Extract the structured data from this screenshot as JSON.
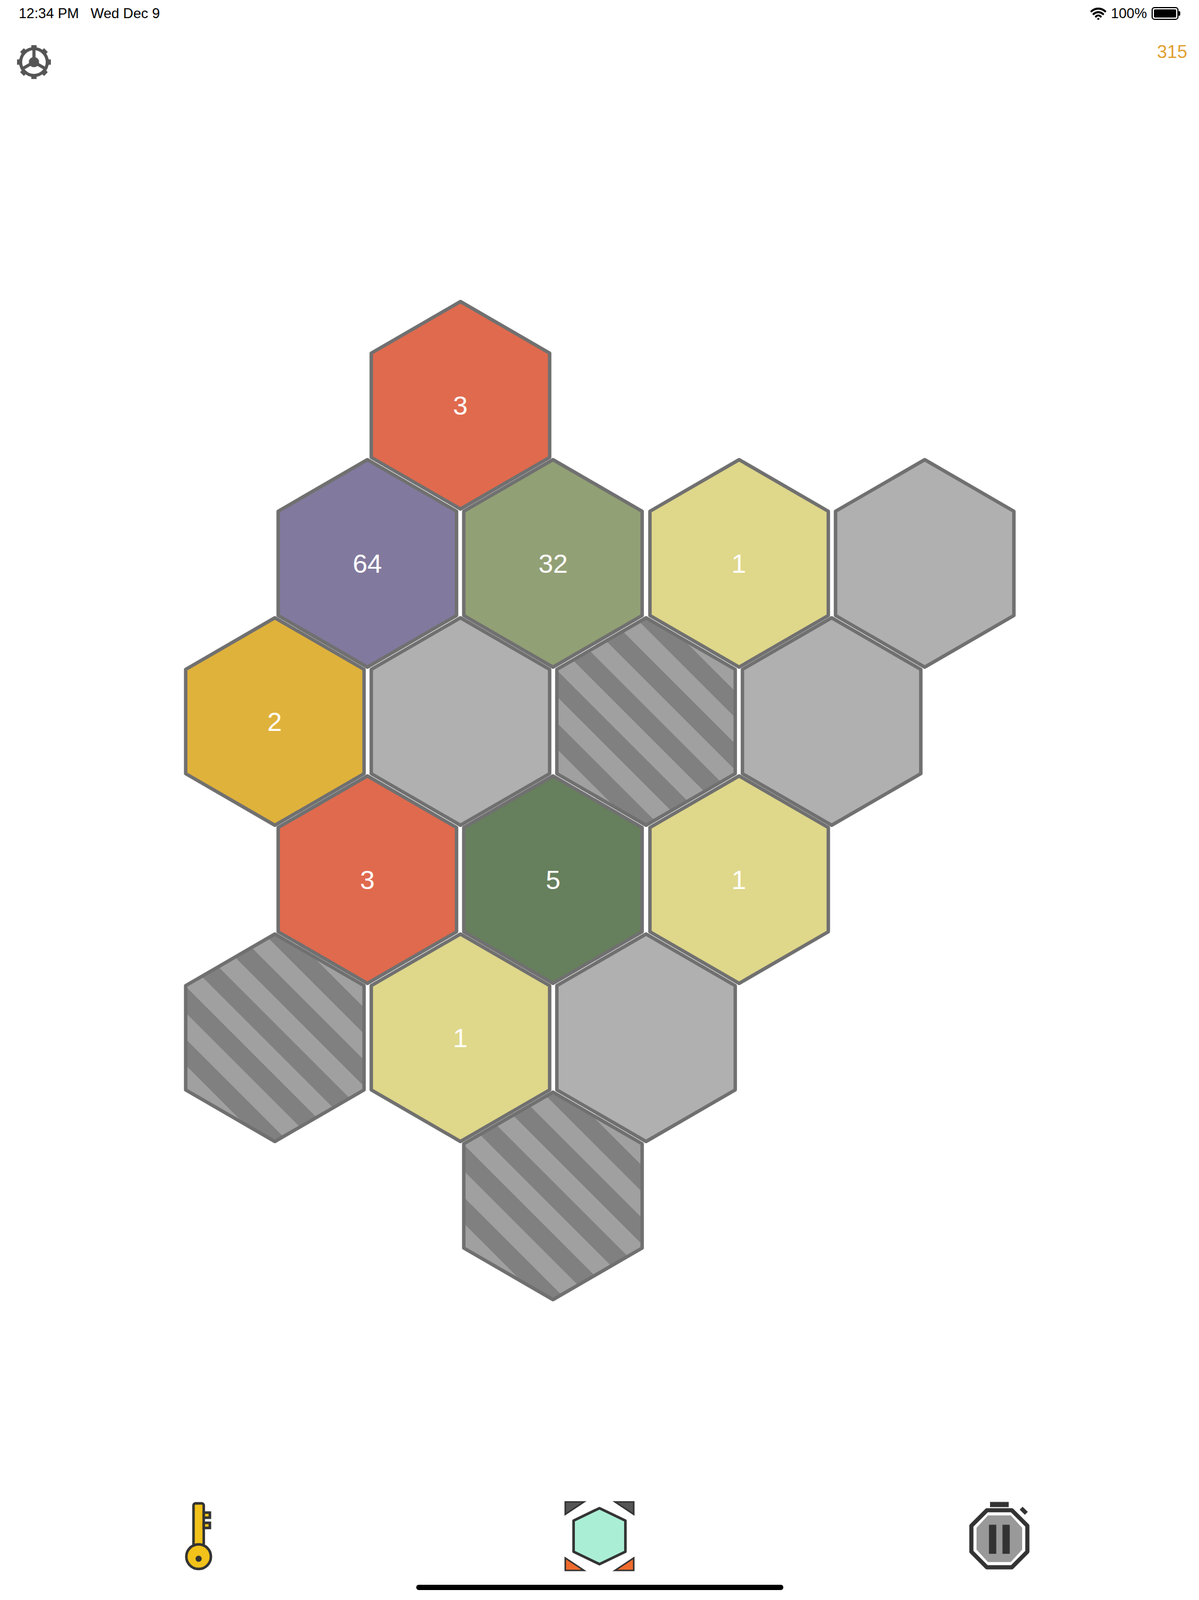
{
  "status_bar": {
    "time": "12:34 PM",
    "date": "Wed Dec 9",
    "battery": "100%",
    "battery_level": 1.0
  },
  "score": "315",
  "board": {
    "cells": [
      {
        "row": 0,
        "col": 2,
        "kind": "number",
        "value": "3",
        "color": "#e06a4e"
      },
      {
        "row": 1,
        "col": 1,
        "kind": "number",
        "value": "64",
        "color": "#82799e"
      },
      {
        "row": 1,
        "col": 3,
        "kind": "number",
        "value": "32",
        "color": "#92a075"
      },
      {
        "row": 1,
        "col": 5,
        "kind": "number",
        "value": "1",
        "color": "#dfd78a"
      },
      {
        "row": 1,
        "col": 7,
        "kind": "empty",
        "color": "#b0b0b0"
      },
      {
        "row": 2,
        "col": 0,
        "kind": "number",
        "value": "2",
        "color": "#dfb23b"
      },
      {
        "row": 2,
        "col": 2,
        "kind": "empty",
        "color": "#b0b0b0"
      },
      {
        "row": 2,
        "col": 4,
        "kind": "blocked",
        "color": "#808080"
      },
      {
        "row": 2,
        "col": 6,
        "kind": "empty",
        "color": "#b0b0b0"
      },
      {
        "row": 3,
        "col": 1,
        "kind": "number",
        "value": "3",
        "color": "#e06a4e"
      },
      {
        "row": 3,
        "col": 3,
        "kind": "number",
        "value": "5",
        "color": "#667f5c"
      },
      {
        "row": 3,
        "col": 5,
        "kind": "number",
        "value": "1",
        "color": "#dfd78a"
      },
      {
        "row": 4,
        "col": 0,
        "kind": "blocked",
        "color": "#808080"
      },
      {
        "row": 4,
        "col": 2,
        "kind": "number",
        "value": "1",
        "color": "#dfd78a"
      },
      {
        "row": 4,
        "col": 4,
        "kind": "empty",
        "color": "#b0b0b0"
      },
      {
        "row": 5,
        "col": 3,
        "kind": "blocked",
        "color": "#808080"
      }
    ]
  }
}
